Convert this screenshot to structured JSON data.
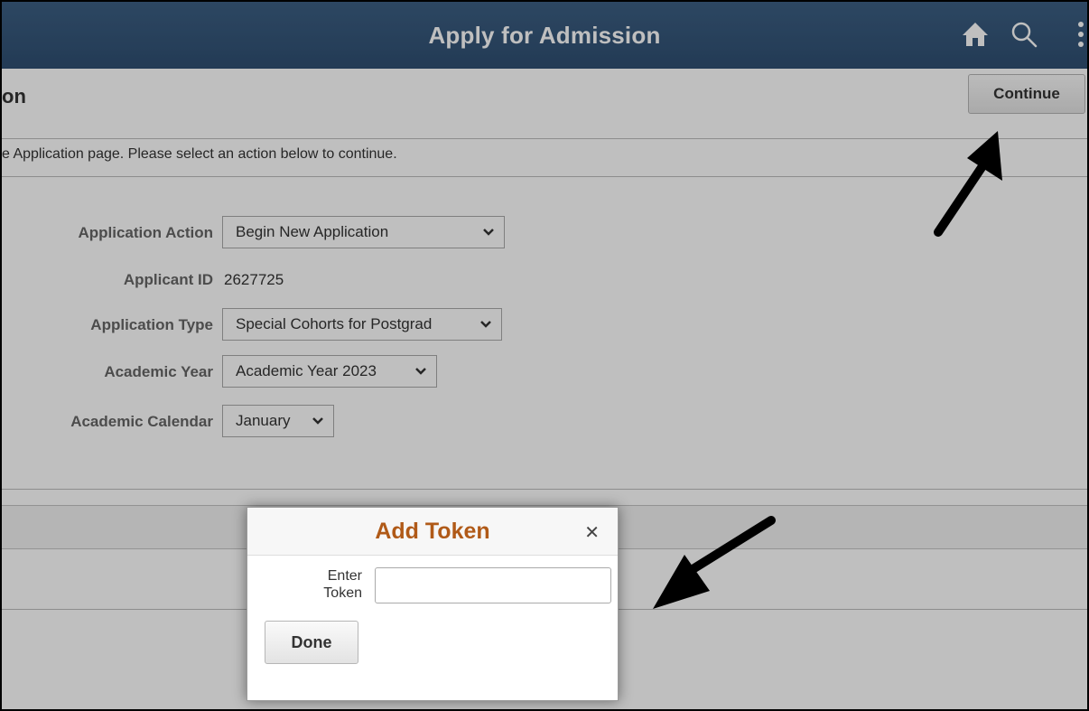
{
  "header": {
    "title": "Apply for Admission",
    "icons": [
      "home-icon",
      "search-icon",
      "more-options-icon"
    ]
  },
  "page": {
    "title": "on",
    "continue_label": "Continue",
    "instruction": "e Application page. Please select an action below to continue."
  },
  "form": {
    "application_action": {
      "label": "Application Action",
      "value": "Begin New Application"
    },
    "applicant_id": {
      "label": "Applicant ID",
      "value": "2627725"
    },
    "application_type": {
      "label": "Application Type",
      "value": "Special Cohorts for Postgrad"
    },
    "academic_year": {
      "label": "Academic Year",
      "value": "Academic Year 2023"
    },
    "academic_calendar": {
      "label": "Academic Calendar",
      "value": "January"
    }
  },
  "modal": {
    "title": "Add Token",
    "close_icon": "close-icon",
    "field_label_line1": "Enter",
    "field_label_line2": "Token",
    "input_value": "",
    "done_label": "Done"
  },
  "colors": {
    "header_bg": "#2f4f72",
    "modal_title": "#b05a18",
    "overlay": "rgba(0,0,0,0.25)"
  }
}
